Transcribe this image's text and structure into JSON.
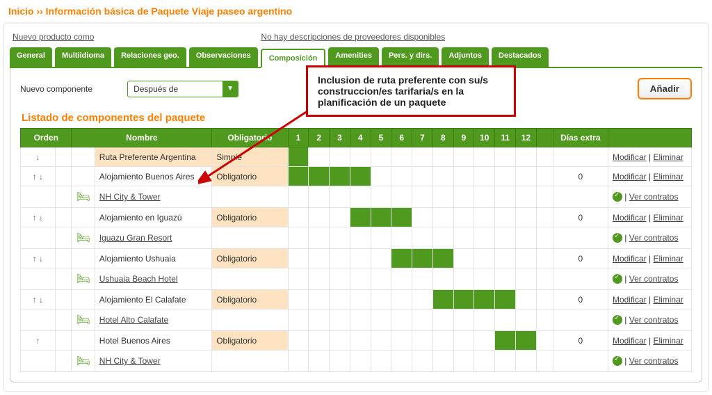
{
  "breadcrumb": {
    "home": "Inicio",
    "sep": "››",
    "title": "Información básica de Paquete Viaje paseo argentino"
  },
  "top": {
    "new_as": "Nuevo producto como",
    "nodesc": "No hay descripciones de proveedores disponibles"
  },
  "tabs": [
    {
      "id": "general",
      "label": "General"
    },
    {
      "id": "multiidioma",
      "label": "Multiidioma"
    },
    {
      "id": "relgeo",
      "label": "Relaciones geo."
    },
    {
      "id": "observ",
      "label": "Observaciones"
    },
    {
      "id": "compos",
      "label": "Composición",
      "active": true
    },
    {
      "id": "amen",
      "label": "Amenities"
    },
    {
      "id": "pers",
      "label": "Pers. y dirs."
    },
    {
      "id": "adj",
      "label": "Adjuntos"
    },
    {
      "id": "dest",
      "label": "Destacados"
    }
  ],
  "newcomp": {
    "label": "Nuevo componente",
    "select_value": "Después de",
    "add": "Añadir"
  },
  "callout_text": "Inclusion de ruta preferente con su/s construccion/es tarifaria/s en la planificación de un paquete",
  "section_title": "Listado de componentes del paquete",
  "headers": {
    "orden": "Orden",
    "nombre": "Nombre",
    "oblig": "Obligatorio",
    "dias_extra": "Días extra"
  },
  "actions": {
    "modificar": "Modificar",
    "eliminar": "Eliminar",
    "ver_contratos": "Ver contratos"
  },
  "oblig": {
    "simple": "Simple",
    "oblig": "Obligatorio"
  },
  "days": [
    "1",
    "2",
    "3",
    "4",
    "5",
    "6",
    "7",
    "8",
    "9",
    "10",
    "11",
    "12"
  ],
  "rows": [
    {
      "kind": "comp",
      "ord": "↓",
      "name": "Ruta Preferente Argentina",
      "name_hi": true,
      "oblig": "simple",
      "oblig_hi": true,
      "days": [
        1
      ],
      "extra": "",
      "acts": "me"
    },
    {
      "kind": "comp",
      "ord": "↑   ↓",
      "name": "Alojamiento Buenos Aires",
      "oblig": "oblig",
      "oblig_hi": true,
      "days": [
        1,
        2,
        3,
        4
      ],
      "extra": "0",
      "acts": "me"
    },
    {
      "kind": "hotel",
      "hotel": "NH City & Tower"
    },
    {
      "kind": "comp",
      "ord": "↑   ↓",
      "name": "Alojamiento en Iguazú",
      "oblig": "oblig",
      "oblig_hi": true,
      "days": [
        4,
        5,
        6
      ],
      "extra": "0",
      "acts": "me"
    },
    {
      "kind": "hotel",
      "hotel": "Iguazu Gran Resort"
    },
    {
      "kind": "comp",
      "ord": "↑   ↓",
      "name": "Alojamiento Ushuaia",
      "oblig": "oblig",
      "oblig_hi": true,
      "days": [
        6,
        7,
        8
      ],
      "extra": "0",
      "acts": "me"
    },
    {
      "kind": "hotel",
      "hotel": "Ushuaia Beach Hotel"
    },
    {
      "kind": "comp",
      "ord": "↑   ↓",
      "name": "Alojamiento El Calafate",
      "oblig": "oblig",
      "oblig_hi": true,
      "days": [
        8,
        9,
        10,
        11
      ],
      "extra": "0",
      "acts": "me"
    },
    {
      "kind": "hotel",
      "hotel": "Hotel Alto Calafate"
    },
    {
      "kind": "comp",
      "ord": "↑",
      "name": "Hotel Buenos Aires",
      "oblig": "oblig",
      "oblig_hi": true,
      "days": [
        11,
        12
      ],
      "extra": "0",
      "acts": "me"
    },
    {
      "kind": "hotel",
      "hotel": "NH City & Tower"
    }
  ]
}
